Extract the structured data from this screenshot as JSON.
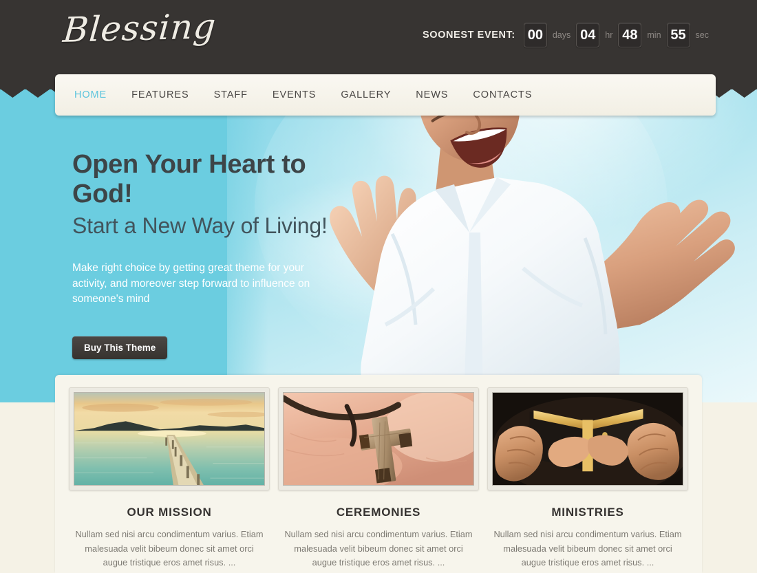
{
  "site": {
    "logo_text": "Blessing",
    "accent_color": "#5bc4dd",
    "hero_bg_color": "#6bcde0",
    "header_bg_color": "#373432",
    "panel_bg_color": "#f7f5ec"
  },
  "countdown": {
    "label": "SOONEST EVENT:",
    "days_value": "00",
    "days_unit": "days",
    "hours_value": "04",
    "hours_unit": "hr",
    "minutes_value": "48",
    "minutes_unit": "min",
    "seconds_value": "55",
    "seconds_unit": "sec"
  },
  "nav": {
    "items": [
      {
        "label": "HOME",
        "active": true
      },
      {
        "label": "FEATURES",
        "active": false
      },
      {
        "label": "STAFF",
        "active": false
      },
      {
        "label": "EVENTS",
        "active": false
      },
      {
        "label": "GALLERY",
        "active": false
      },
      {
        "label": "NEWS",
        "active": false
      },
      {
        "label": "CONTACTS",
        "active": false
      }
    ]
  },
  "hero": {
    "heading": "Open Your Heart to God!",
    "subheading": "Start a New Way of Living!",
    "paragraph": "Make right choice by getting great theme for your activity, and moreover step forward to influence on someone's mind",
    "button_label": "Buy This Theme",
    "image_alt": "joyful-man-arms-raised-sky"
  },
  "cards": [
    {
      "title": "OUR MISSION",
      "body": "Nullam sed nisi arcu condimentum varius. Etiam malesuada velit bibeum donec sit amet orci augue tristique eros amet risus. ...",
      "image_alt": "sunset-lake-pier-photo"
    },
    {
      "title": "CEREMONIES",
      "body": "Nullam sed nisi arcu condimentum varius. Etiam malesuada velit bibeum donec sit amet orci augue tristique eros amet risus. ...",
      "image_alt": "wooden-cross-in-hand-photo"
    },
    {
      "title": "MINISTRIES",
      "body": "Nullam sed nisi arcu condimentum varius. Etiam malesuada velit bibeum donec sit amet orci augue tristique eros amet risus. ...",
      "image_alt": "hands-holding-open-bible-photo"
    }
  ]
}
